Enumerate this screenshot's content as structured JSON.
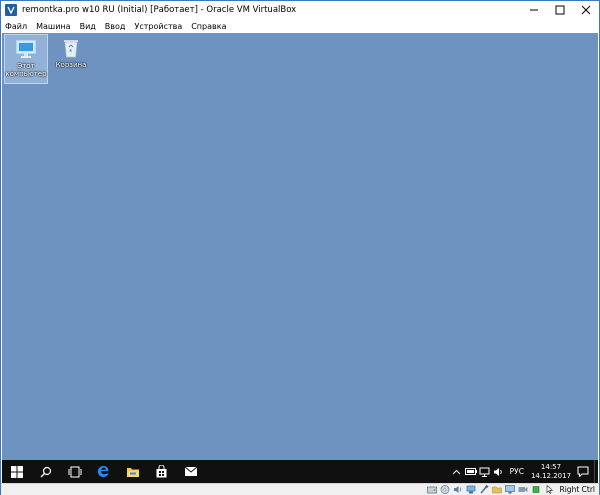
{
  "window": {
    "title": "remontka.pro w10 RU (Initial) [Работает] - Oracle VM VirtualBox",
    "icons": [
      "virtualbox-icon",
      "minimize-icon",
      "maximize-icon",
      "close-icon"
    ]
  },
  "menu": {
    "items": [
      {
        "label": "Файл"
      },
      {
        "label": "Машина"
      },
      {
        "label": "Вид"
      },
      {
        "label": "Ввод"
      },
      {
        "label": "Устройства"
      },
      {
        "label": "Справка"
      }
    ]
  },
  "desktop": {
    "background": "#6e93c0",
    "icons": [
      {
        "label": "Этот компьютер",
        "icon": "computer-icon",
        "selected": true
      },
      {
        "label": "Корзина",
        "icon": "recycle-bin-icon",
        "selected": false
      }
    ]
  },
  "taskbar": {
    "buttons": [
      "start-icon",
      "search-icon",
      "task-view-icon",
      "edge-icon",
      "file-explorer-icon",
      "store-icon",
      "mail-icon"
    ],
    "tray": {
      "icons": [
        "chevron-up-icon",
        "battery-icon",
        "network-icon",
        "volume-icon"
      ],
      "language": "РУС",
      "time": "14:57",
      "date": "14.12.2017",
      "notification_icon": "notification-icon"
    }
  },
  "statusbar": {
    "icons": [
      "hdd-icon",
      "optical-icon",
      "audio-icon",
      "network-icon",
      "usb-icon",
      "shared-folder-icon",
      "display-icon",
      "recording-icon",
      "cpu-icon",
      "mouse-integration-icon"
    ],
    "host_key": "Right Ctrl"
  }
}
